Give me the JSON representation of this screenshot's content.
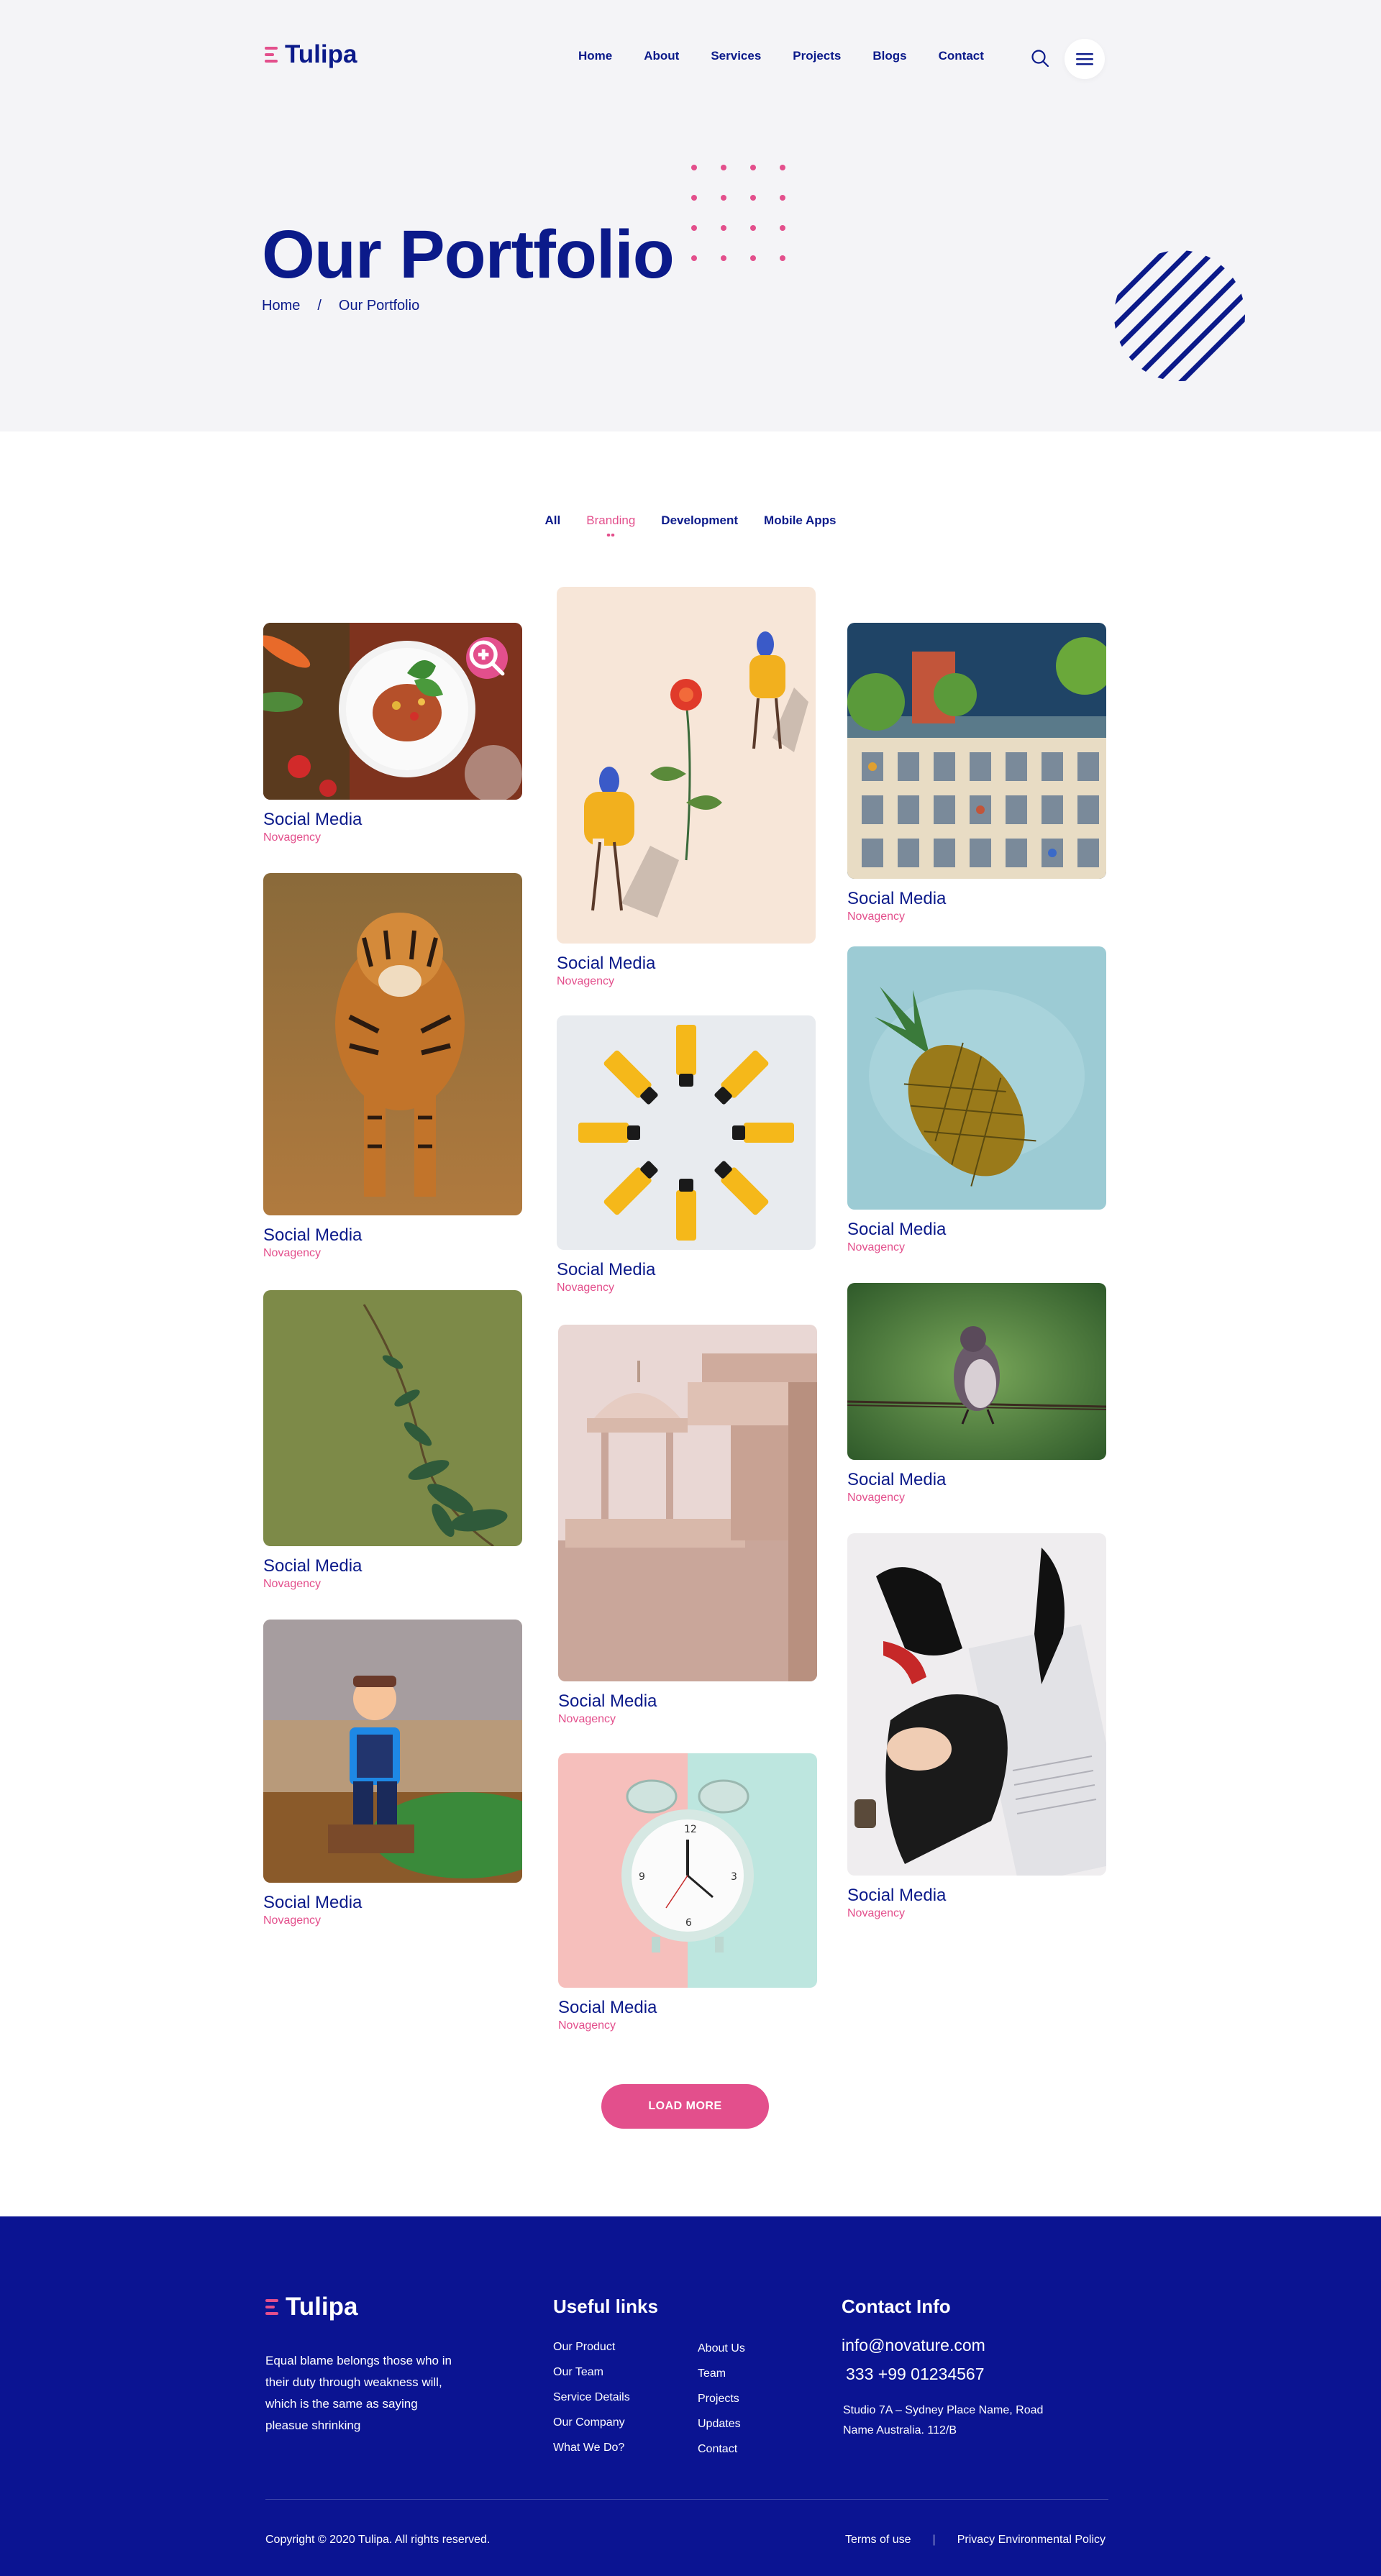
{
  "brand": {
    "name": "Tulipa"
  },
  "nav": {
    "items": [
      "Home",
      "About",
      "Services",
      "Projects",
      "Blogs",
      "Contact"
    ]
  },
  "hero": {
    "title": "Our Portfolio",
    "breadcrumb": {
      "home": "Home",
      "separator": "/",
      "current": "Our Portfolio"
    }
  },
  "filters": {
    "items": [
      "All",
      "Branding",
      "Development",
      "Mobile Apps"
    ],
    "active": "Branding"
  },
  "portfolio": {
    "items": [
      {
        "title": "Social Media",
        "client": "Novagency",
        "image": "food-plate"
      },
      {
        "title": "Social Media",
        "client": "Novagency",
        "image": "tiger"
      },
      {
        "title": "Social Media",
        "client": "Novagency",
        "image": "plant-branch"
      },
      {
        "title": "Social Media",
        "client": "Novagency",
        "image": "police-toy"
      },
      {
        "title": "Social Media",
        "client": "Novagency",
        "image": "illustration-flower"
      },
      {
        "title": "Social Media",
        "client": "Novagency",
        "image": "yellow-tubes"
      },
      {
        "title": "Social Media",
        "client": "Novagency",
        "image": "architecture"
      },
      {
        "title": "Social Media",
        "client": "Novagency",
        "image": "alarm-clock"
      },
      {
        "title": "Social Media",
        "client": "Novagency",
        "image": "illustrated-building"
      },
      {
        "title": "Social Media",
        "client": "Novagency",
        "image": "pineapple"
      },
      {
        "title": "Social Media",
        "client": "Novagency",
        "image": "bird-on-wire"
      },
      {
        "title": "Social Media",
        "client": "Novagency",
        "image": "fashion-shoes"
      }
    ],
    "load_more": "LOAD MORE"
  },
  "footer": {
    "description": "Equal blame belongs those who in their duty through weakness will, which is the same as saying pleasue shrinking",
    "useful_links": {
      "heading": "Useful links",
      "col1": [
        "Our Product",
        "Our Team",
        "Service Details",
        "Our Company",
        "What We Do?"
      ],
      "col2": [
        "About Us",
        "Team",
        "Projects",
        "Updates",
        "Contact"
      ]
    },
    "contact": {
      "heading": "Contact Info",
      "email": "info@novature.com",
      "phone": "333 +99 01234567",
      "address": "Studio 7A – Sydney Place Name, Road Name Australia. 112/B"
    },
    "copyright": "Copyright © 2020 Tulipa. All rights reserved.",
    "legal": {
      "terms": "Terms of use",
      "separator": "|",
      "privacy": "Privacy Environmental Policy"
    }
  },
  "colors": {
    "primary": "#0b1a8a",
    "accent": "#e34f8c",
    "hero_bg": "#f4f4f7",
    "footer_bg": "#0b1492"
  }
}
